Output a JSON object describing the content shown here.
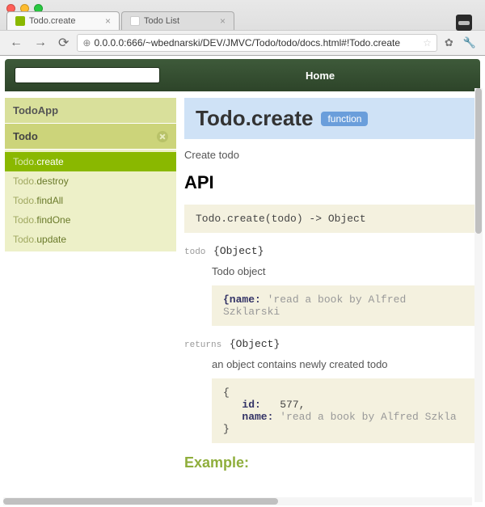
{
  "browser": {
    "tabs": [
      {
        "title": "Todo.create"
      },
      {
        "title": "Todo List"
      }
    ],
    "url": "0.0.0.0:666/~wbednarski/DEV/JMVC/Todo/todo/docs.html#!Todo.create"
  },
  "topbar": {
    "home": "Home"
  },
  "sidebar": {
    "heads": [
      {
        "label": "TodoApp"
      },
      {
        "label": "Todo"
      }
    ],
    "items": [
      {
        "prefix": "Todo.",
        "name": "create",
        "selected": true
      },
      {
        "prefix": "Todo.",
        "name": "destroy"
      },
      {
        "prefix": "Todo.",
        "name": "findAll"
      },
      {
        "prefix": "Todo.",
        "name": "findOne"
      },
      {
        "prefix": "Todo.",
        "name": "update"
      }
    ]
  },
  "doc": {
    "title": "Todo.create",
    "badge": "function",
    "description": "Create todo",
    "api_heading": "API",
    "signature": "Todo.create(todo) -> Object",
    "param": {
      "label": "todo",
      "type": "{Object}",
      "desc": "Todo object",
      "code": "{name: 'read a book by Alfred Szklarski"
    },
    "returns": {
      "label": "returns",
      "type": "{Object}",
      "desc": "an object contains newly created todo",
      "code": "{\n   id:   577,\n   name: 'read a book by Alfred Szkla\n}"
    },
    "example_heading": "Example:"
  }
}
